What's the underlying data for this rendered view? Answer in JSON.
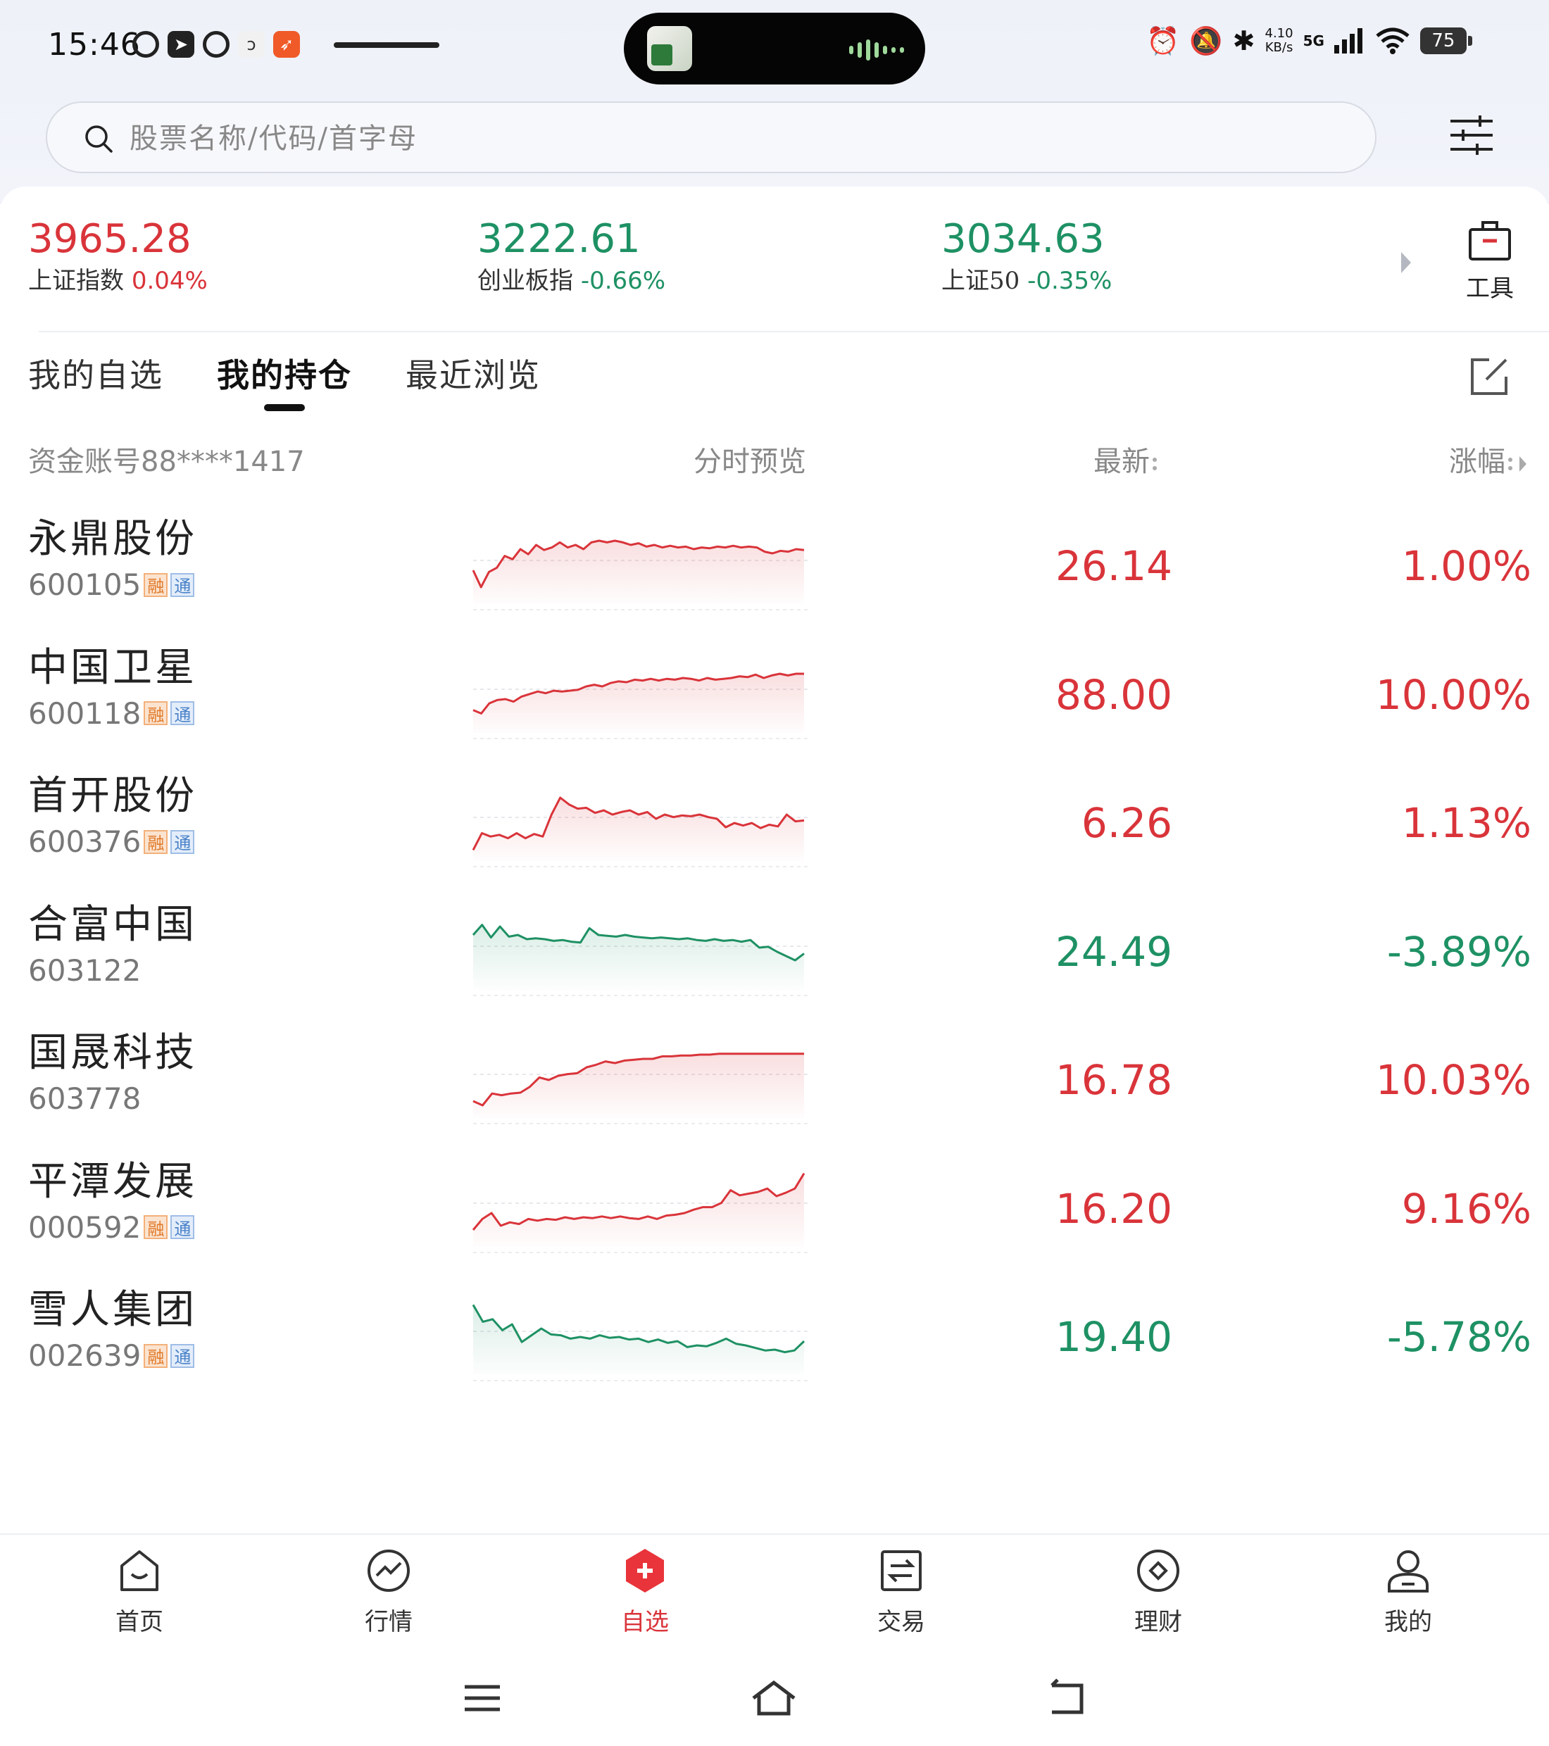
{
  "status_bar": {
    "time": "15:46",
    "net_speed": "4.10",
    "net_speed_unit": "KB/s",
    "network": "5G",
    "battery": "75"
  },
  "search": {
    "placeholder": "股票名称/代码/首字母"
  },
  "indices": [
    {
      "value": "3965.28",
      "name": "上证指数",
      "change": "0.04%",
      "trend": "up"
    },
    {
      "value": "3222.61",
      "name": "创业板指",
      "change": "-0.66%",
      "trend": "down"
    },
    {
      "value": "3034.63",
      "name": "上证50",
      "change": "-0.35%",
      "trend": "down"
    }
  ],
  "tools_label": "工具",
  "tabs": [
    {
      "label": "我的自选",
      "active": false
    },
    {
      "label": "我的持仓",
      "active": true
    },
    {
      "label": "最近浏览",
      "active": false
    }
  ],
  "columns": {
    "account_prefix": "资金账号",
    "account": "88****1417",
    "preview": "分时预览",
    "latest": "最新",
    "change": "涨幅"
  },
  "tags": {
    "rong": "融",
    "tong": "通"
  },
  "colors": {
    "up": "#d9343a",
    "down": "#1e9164"
  },
  "stocks": [
    {
      "name": "永鼎股份",
      "code": "600105",
      "rong": true,
      "tong": true,
      "price": "26.14",
      "change": "1.00%",
      "trend": "up",
      "spark": [
        0.55,
        0.75,
        0.57,
        0.52,
        0.38,
        0.42,
        0.3,
        0.36,
        0.25,
        0.31,
        0.28,
        0.22,
        0.28,
        0.25,
        0.3,
        0.22,
        0.2,
        0.22,
        0.2,
        0.22,
        0.25,
        0.23,
        0.27,
        0.25,
        0.28,
        0.26,
        0.28,
        0.27,
        0.3,
        0.28,
        0.29,
        0.27,
        0.28,
        0.26,
        0.28,
        0.27,
        0.28,
        0.33,
        0.35,
        0.32,
        0.33,
        0.3,
        0.31
      ]
    },
    {
      "name": "中国卫星",
      "code": "600118",
      "rong": true,
      "tong": true,
      "price": "88.00",
      "change": "10.00%",
      "trend": "up",
      "spark": [
        0.68,
        0.72,
        0.6,
        0.56,
        0.55,
        0.58,
        0.52,
        0.49,
        0.46,
        0.48,
        0.45,
        0.46,
        0.45,
        0.44,
        0.4,
        0.38,
        0.4,
        0.36,
        0.34,
        0.35,
        0.32,
        0.33,
        0.31,
        0.33,
        0.31,
        0.32,
        0.3,
        0.31,
        0.33,
        0.3,
        0.32,
        0.31,
        0.3,
        0.28,
        0.29,
        0.26,
        0.3,
        0.27,
        0.25,
        0.27,
        0.25,
        0.25
      ]
    },
    {
      "name": "首开股份",
      "code": "600376",
      "rong": true,
      "tong": true,
      "price": "6.26",
      "change": "1.13%",
      "trend": "up",
      "spark": [
        0.82,
        0.62,
        0.66,
        0.64,
        0.68,
        0.62,
        0.68,
        0.63,
        0.66,
        0.4,
        0.2,
        0.28,
        0.33,
        0.32,
        0.38,
        0.35,
        0.4,
        0.37,
        0.35,
        0.4,
        0.37,
        0.45,
        0.4,
        0.43,
        0.41,
        0.42,
        0.4,
        0.43,
        0.45,
        0.55,
        0.5,
        0.53,
        0.5,
        0.56,
        0.52,
        0.54,
        0.4,
        0.48,
        0.47
      ]
    },
    {
      "name": "合富中国",
      "code": "603122",
      "rong": false,
      "tong": false,
      "price": "24.49",
      "change": "-3.89%",
      "trend": "down",
      "spark": [
        0.3,
        0.18,
        0.33,
        0.2,
        0.32,
        0.3,
        0.35,
        0.34,
        0.35,
        0.37,
        0.36,
        0.38,
        0.39,
        0.22,
        0.3,
        0.31,
        0.32,
        0.3,
        0.32,
        0.33,
        0.34,
        0.33,
        0.34,
        0.35,
        0.34,
        0.36,
        0.37,
        0.35,
        0.37,
        0.36,
        0.38,
        0.36,
        0.45,
        0.44,
        0.5,
        0.55,
        0.6,
        0.52
      ]
    },
    {
      "name": "国晟科技",
      "code": "603778",
      "rong": false,
      "tong": false,
      "price": "16.78",
      "change": "10.03%",
      "trend": "up",
      "spark": [
        0.75,
        0.8,
        0.66,
        0.68,
        0.66,
        0.65,
        0.58,
        0.47,
        0.5,
        0.45,
        0.43,
        0.42,
        0.35,
        0.32,
        0.28,
        0.3,
        0.27,
        0.26,
        0.25,
        0.25,
        0.22,
        0.22,
        0.21,
        0.21,
        0.2,
        0.2,
        0.19,
        0.19,
        0.19,
        0.19,
        0.19,
        0.19,
        0.19,
        0.19,
        0.19,
        0.19
      ]
    },
    {
      "name": "平潭发展",
      "code": "000592",
      "rong": true,
      "tong": true,
      "price": "16.20",
      "change": "9.16%",
      "trend": "up",
      "spark": [
        0.75,
        0.62,
        0.55,
        0.7,
        0.66,
        0.68,
        0.62,
        0.64,
        0.62,
        0.63,
        0.6,
        0.62,
        0.6,
        0.61,
        0.59,
        0.61,
        0.59,
        0.61,
        0.62,
        0.59,
        0.62,
        0.58,
        0.57,
        0.55,
        0.51,
        0.48,
        0.48,
        0.43,
        0.28,
        0.34,
        0.32,
        0.3,
        0.26,
        0.35,
        0.31,
        0.26,
        0.08
      ]
    },
    {
      "name": "雪人集团",
      "code": "002639",
      "rong": true,
      "tong": true,
      "price": "19.40",
      "change": "-5.78%",
      "trend": "down",
      "spark": [
        0.12,
        0.32,
        0.29,
        0.42,
        0.35,
        0.56,
        0.48,
        0.4,
        0.47,
        0.48,
        0.52,
        0.5,
        0.52,
        0.48,
        0.51,
        0.5,
        0.53,
        0.52,
        0.56,
        0.53,
        0.57,
        0.55,
        0.62,
        0.6,
        0.61,
        0.57,
        0.52,
        0.58,
        0.6,
        0.63,
        0.66,
        0.65,
        0.68,
        0.66,
        0.55
      ]
    }
  ],
  "bottom_nav": [
    {
      "label": "首页",
      "icon": "home-icon",
      "active": false
    },
    {
      "label": "行情",
      "icon": "market-icon",
      "active": false
    },
    {
      "label": "自选",
      "icon": "favorites-icon",
      "active": true
    },
    {
      "label": "交易",
      "icon": "trade-icon",
      "active": false
    },
    {
      "label": "理财",
      "icon": "wealth-icon",
      "active": false
    },
    {
      "label": "我的",
      "icon": "profile-icon",
      "active": false
    }
  ]
}
